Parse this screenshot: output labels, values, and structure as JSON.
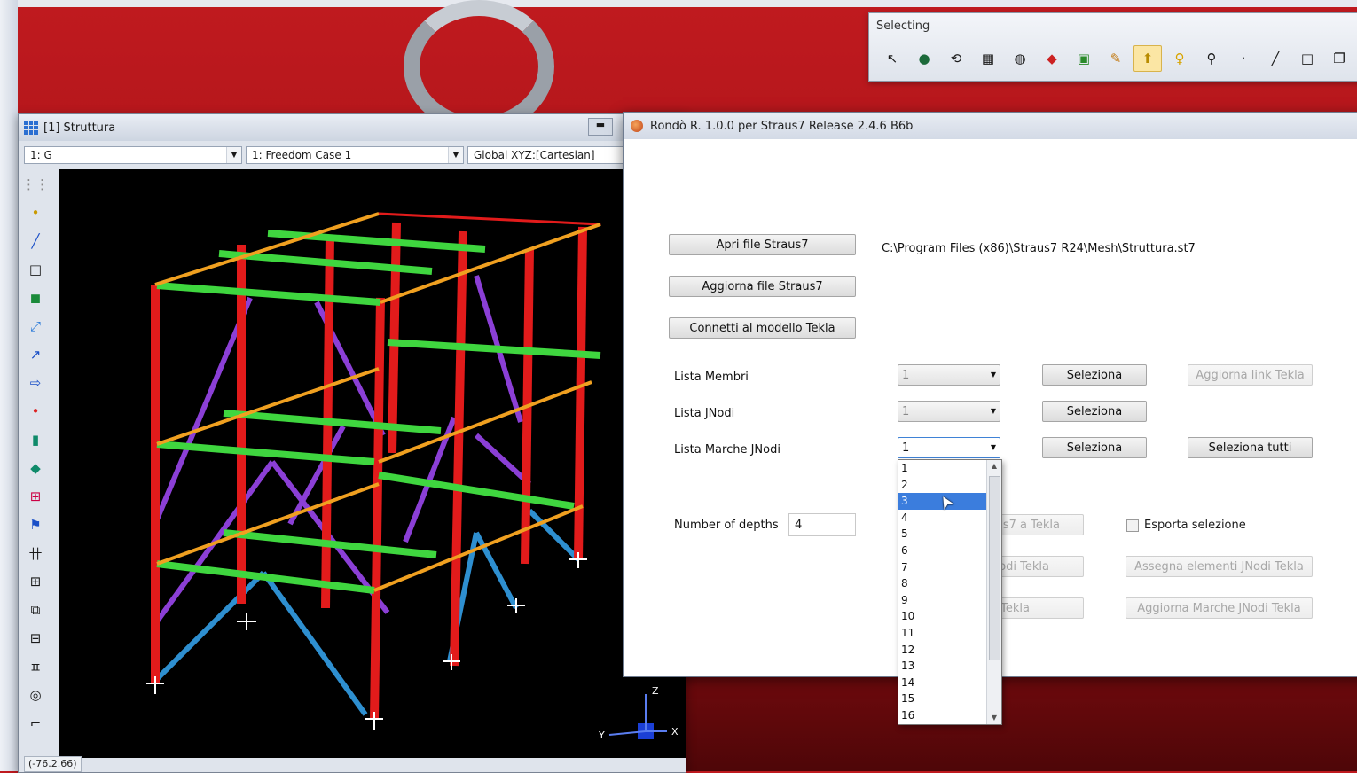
{
  "selecting_toolbar": {
    "title": "Selecting",
    "icons": [
      "pointer-select-icon",
      "globe-icon",
      "rotate-icon",
      "grid-icon",
      "sphere-icon",
      "node-select-icon",
      "copy-select-icon",
      "brush-icon",
      "bulb-up-icon",
      "bulb-icon",
      "pin-icon",
      "point-icon",
      "line-icon",
      "rectangle-icon",
      "box-icon",
      "polyline-icon"
    ],
    "active_index": 8
  },
  "model_window": {
    "title": "[1] Struttura",
    "combo_group": "1: G",
    "combo_freedom": "1: Freedom Case 1",
    "combo_coords": "Global XYZ:[Cartesian]",
    "status": "(-76.2.66)",
    "axis_z": "Z",
    "axis_x": "X",
    "axis_y": "Y",
    "left_tools": [
      "dots-grid-icon",
      "node-icon",
      "beam-icon",
      "plate-icon",
      "brick-icon",
      "link-icon",
      "arrow-tool-icon",
      "box-arrow-icon",
      "point-red-icon",
      "cylinder-icon",
      "gem-icon",
      "frame-icon",
      "flag-icon",
      "truss-icon",
      "table-icon",
      "mesh-icon",
      "assembly-icon",
      "tower-icon",
      "coil-icon",
      "stair-icon"
    ]
  },
  "dialog": {
    "title": "Rondò R. 1.0.0 per Straus7 Release 2.4.6 B6b",
    "btn_open": "Apri file Straus7",
    "file_path": "C:\\Program Files (x86)\\Straus7 R24\\Mesh\\Struttura.st7",
    "btn_update": "Aggiorna file Straus7",
    "btn_connect": "Connetti al modello Tekla",
    "lista_membri_label": "Lista Membri",
    "lista_membri_value": "1",
    "lista_jnodi_label": "Lista JNodi",
    "lista_jnodi_value": "1",
    "lista_marche_label": "Lista Marche JNodi",
    "lista_marche_value": "1",
    "btn_seleziona": "Seleziona",
    "btn_aggiorna_link": "Aggiorna link Tekla",
    "btn_seleziona_tutti": "Seleziona tutti",
    "depths_label": "Number of depths",
    "depths_value": "4",
    "btn_export_partial": "us7 a Tekla",
    "export_selection_label": "Esporta selezione",
    "btn_jnodi_partial": "odi Tekla",
    "btn_assegna": "Assegna elementi JNodi Tekla",
    "btn_tekla_partial": "i Tekla",
    "btn_aggiorna_marche": "Aggiorna Marche JNodi Tekla"
  },
  "dropdown_list": {
    "items": [
      "1",
      "2",
      "3",
      "4",
      "5",
      "6",
      "7",
      "8",
      "9",
      "10",
      "11",
      "12",
      "13",
      "14",
      "15",
      "16"
    ],
    "selected_index": 2
  }
}
